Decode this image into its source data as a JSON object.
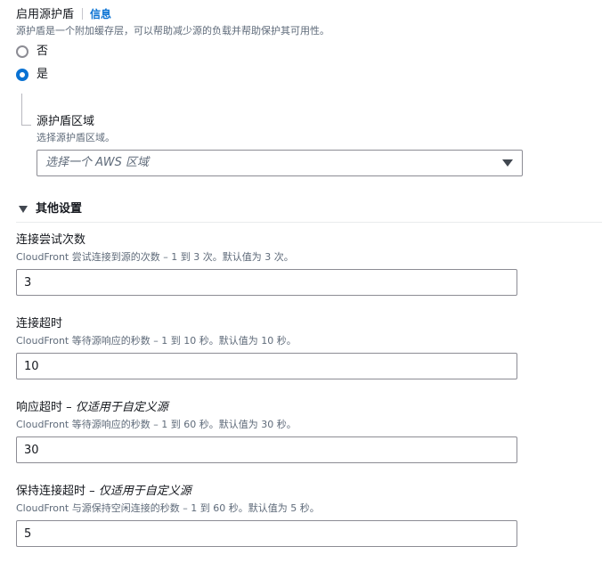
{
  "origin_shield": {
    "label": "启用源护盾",
    "info_link": "信息",
    "description": "源护盾是一个附加缓存层，可以帮助减少源的负载并帮助保护其可用性。",
    "options": [
      {
        "label": "否",
        "selected": false
      },
      {
        "label": "是",
        "selected": true
      }
    ],
    "region": {
      "label": "源护盾区域",
      "description": "选择源护盾区域。",
      "placeholder": "选择一个 AWS 区域"
    }
  },
  "additional_settings": {
    "title": "其他设置",
    "expanded": true
  },
  "connection_attempts": {
    "label": "连接尝试次数",
    "description": "CloudFront 尝试连接到源的次数 – 1 到 3 次。默认值为 3 次。",
    "value": "3"
  },
  "connection_timeout": {
    "label": "连接超时",
    "description": "CloudFront 等待源响应的秒数 – 1 到 10 秒。默认值为 10 秒。",
    "value": "10"
  },
  "response_timeout": {
    "label": "响应超时 – ",
    "label_italic": "仅适用于自定义源",
    "description": "CloudFront 等待源响应的秒数 – 1 到 60 秒。默认值为 30 秒。",
    "value": "30"
  },
  "keepalive_timeout": {
    "label": "保持连接超时 – ",
    "label_italic": "仅适用于自定义源",
    "description": "CloudFront 与源保持空闲连接的秒数 – 1 到 60 秒。默认值为 5 秒。",
    "value": "5"
  }
}
